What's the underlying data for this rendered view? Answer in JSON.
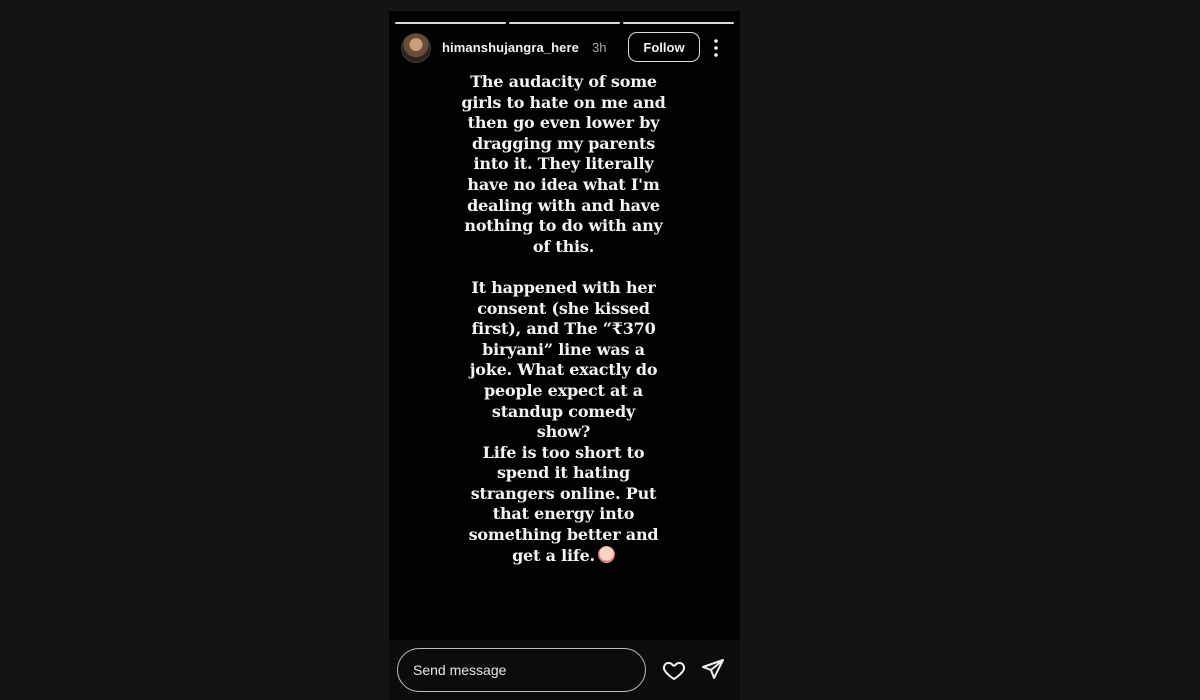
{
  "story": {
    "progress_segments": 3,
    "header": {
      "username": "himanshujangra_here",
      "time_ago": "3h",
      "follow_label": "Follow",
      "more_icon": "more-vertical-icon"
    },
    "text": "The audacity of some\ngirls to hate on me and\nthen go even lower by\ndragging my parents\ninto it. They literally\nhave no idea what I'm\ndealing with and have\nnothing to do with any\nof this.\n\nIt happened with her\nconsent (she kissed\nfirst), and The “₹370\nbiryani” line was a\njoke. What exactly do\npeople expect at a\nstandup comedy\nshow?\nLife is too short to\nspend it hating\nstrangers online. Put\nthat energy into\nsomething better and\nget a life.",
    "emoji_icon": "clown-face-emoji"
  },
  "footer": {
    "send_placeholder": "Send message",
    "like_icon": "heart-icon",
    "share_icon": "send-icon"
  },
  "colors": {
    "page_bg": "#141414",
    "story_bg": "#020202",
    "text": "#f4f4f4",
    "secondary_text": "#a8a8a8"
  }
}
